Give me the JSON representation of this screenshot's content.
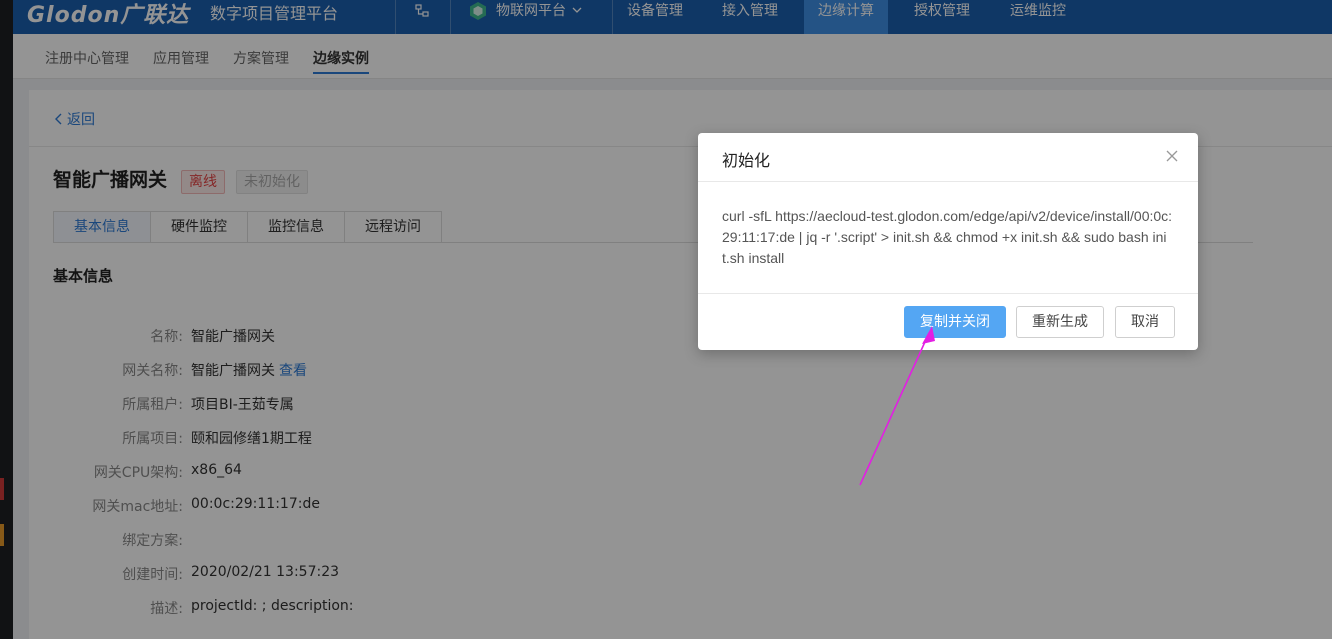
{
  "header": {
    "logo": "Glodon",
    "logo_cn": "广联达",
    "platform": "数字项目管理平台",
    "app_switcher": "物联网平台",
    "nav": [
      "设备管理",
      "接入管理",
      "边缘计算",
      "授权管理",
      "运维监控"
    ],
    "active_nav": "边缘计算"
  },
  "subnav": {
    "items": [
      "注册中心管理",
      "应用管理",
      "方案管理",
      "边缘实例"
    ],
    "active": "边缘实例"
  },
  "page": {
    "back": "返回",
    "title": "智能广播网关",
    "status_offline": "离线",
    "status_uninit": "未初始化",
    "tabs": [
      "基本信息",
      "硬件监控",
      "监控信息",
      "远程访问"
    ],
    "active_tab": "基本信息",
    "section_title": "基本信息",
    "info": [
      {
        "label": "名称:",
        "value": "智能广播网关"
      },
      {
        "label": "网关名称:",
        "value": "智能广播网关",
        "link": "查看"
      },
      {
        "label": "所属租户:",
        "value": "项目BI-王茹专属"
      },
      {
        "label": "所属项目:",
        "value": "颐和园修缮1期工程"
      },
      {
        "label": "网关CPU架构:",
        "value": "x86_64"
      },
      {
        "label": "网关mac地址:",
        "value": "00:0c:29:11:17:de"
      },
      {
        "label": "绑定方案:",
        "value": ""
      },
      {
        "label": "创建时间:",
        "value": "2020/02/21 13:57:23"
      },
      {
        "label": "描述:",
        "value": "projectId: ; description:"
      }
    ]
  },
  "dialog": {
    "title": "初始化",
    "command": "curl -sfL https://aecloud-test.glodon.com/edge/api/v2/device/install/00:0c:29:11:17:de | jq -r '.script' > init.sh && chmod +x init.sh && sudo bash init.sh install",
    "copy_close": "复制并关闭",
    "regenerate": "重新生成",
    "cancel": "取消"
  },
  "colors": {
    "header_bg": "#1b5fae",
    "active_nav_bg": "#3e8fe6",
    "primary": "#54a6f3",
    "link": "#2d7ad6",
    "danger": "#e64545",
    "annotation_arrow": "#e31ee3"
  }
}
